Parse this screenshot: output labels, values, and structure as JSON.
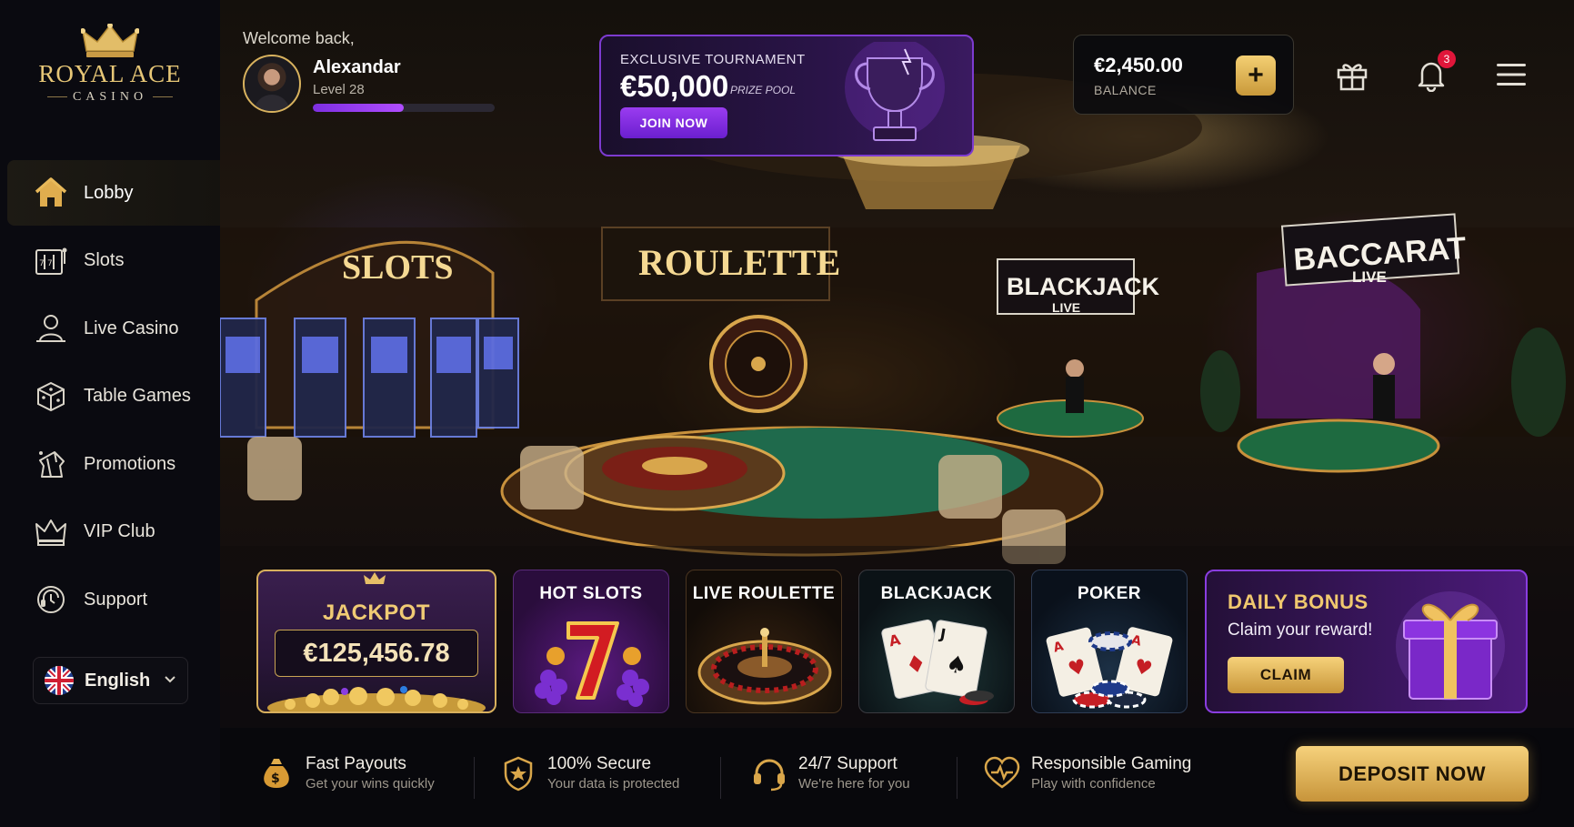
{
  "brand": {
    "name": "ROYAL ACE",
    "sub": "CASINO"
  },
  "user": {
    "welcome": "Welcome back,",
    "name": "Alexandar",
    "level": "Level 28",
    "xp_progress": 0.5
  },
  "tournament": {
    "kicker": "EXCLUSIVE TOURNAMENT",
    "amount": "€50,000",
    "caption": "PRIZE POOL",
    "cta": "JOIN NOW"
  },
  "balance": {
    "amount": "€2,450.00",
    "label": "BALANCE",
    "add_symbol": "+"
  },
  "notifications": {
    "count": "3"
  },
  "sidebar": {
    "items": [
      {
        "label": "Lobby",
        "icon": "home-icon",
        "active": true
      },
      {
        "label": "Slots",
        "icon": "slot-machine-icon"
      },
      {
        "label": "Live Casino",
        "icon": "dealer-icon"
      },
      {
        "label": "Table Games",
        "icon": "dice-icon"
      },
      {
        "label": "Promotions",
        "icon": "gift-icon"
      },
      {
        "label": "VIP Club",
        "icon": "crown-icon"
      },
      {
        "label": "Support",
        "icon": "headset-icon"
      }
    ],
    "language": "English"
  },
  "hero_signs": {
    "slots": "SLOTS",
    "roulette": "ROULETTE",
    "blackjack": "BLACKJACK",
    "blackjack_sub": "LIVE",
    "baccarat": "BACCARAT",
    "baccarat_sub": "LIVE"
  },
  "tiles": {
    "jackpot": {
      "title": "JACKPOT",
      "value": "€125,456.78"
    },
    "hot_slots": "HOT SLOTS",
    "live_roulette": "LIVE ROULETTE",
    "blackjack": "BLACKJACK",
    "poker": "POKER"
  },
  "daily_bonus": {
    "title": "DAILY BONUS",
    "text": "Claim your reward!",
    "cta": "CLAIM"
  },
  "features": [
    {
      "title": "Fast Payouts",
      "sub": "Get your wins quickly",
      "icon": "money-bag-icon"
    },
    {
      "title": "100% Secure",
      "sub": "Your data is protected",
      "icon": "shield-icon"
    },
    {
      "title": "24/7 Support",
      "sub": "We're here for you",
      "icon": "headset-icon"
    },
    {
      "title": "Responsible Gaming",
      "sub": "Play with confidence",
      "icon": "heart-icon"
    }
  ],
  "deposit": {
    "label": "DEPOSIT NOW"
  },
  "colors": {
    "gold": "#e7c777",
    "purple": "#8a3de0",
    "background": "#07070b"
  }
}
